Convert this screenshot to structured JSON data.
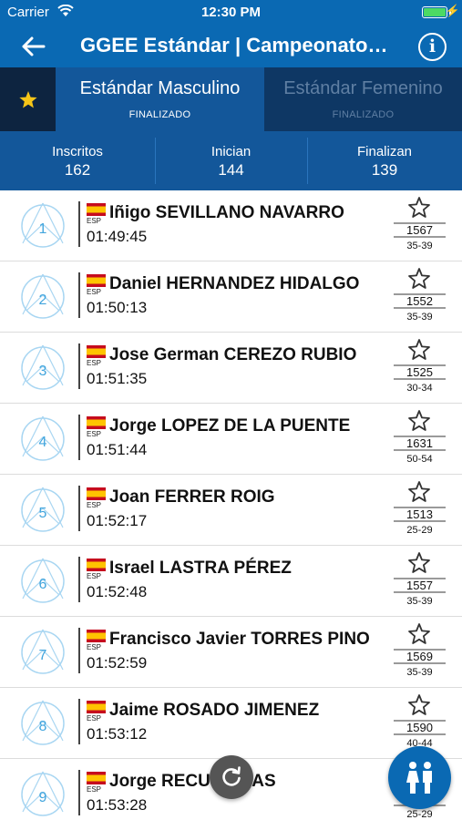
{
  "status_bar": {
    "carrier": "Carrier",
    "time": "12:30 PM"
  },
  "navbar": {
    "title": "GGEE Estándar | Campeonato…",
    "back_icon": "back-arrow-icon",
    "info_icon": "info-icon",
    "info_glyph": "i"
  },
  "tabs": [
    {
      "label": "Estándar Masculino",
      "status": "FINALIZADO",
      "active": true
    },
    {
      "label": "Estándar Femenino",
      "status": "FINALIZADO",
      "active": false
    }
  ],
  "stats": [
    {
      "label": "Inscritos",
      "value": "162"
    },
    {
      "label": "Inician",
      "value": "144"
    },
    {
      "label": "Finalizan",
      "value": "139"
    }
  ],
  "results": [
    {
      "position": "1",
      "country": "ESP",
      "name": "Iñigo SEVILLANO NAVARRO",
      "time": "01:49:45",
      "score": "1567",
      "category": "35-39"
    },
    {
      "position": "2",
      "country": "ESP",
      "name": "Daniel HERNANDEZ HIDALGO",
      "time": "01:50:13",
      "score": "1552",
      "category": "35-39"
    },
    {
      "position": "3",
      "country": "ESP",
      "name": "Jose German CEREZO RUBIO",
      "time": "01:51:35",
      "score": "1525",
      "category": "30-34"
    },
    {
      "position": "4",
      "country": "ESP",
      "name": "Jorge LOPEZ DE LA PUENTE",
      "time": "01:51:44",
      "score": "1631",
      "category": "50-54"
    },
    {
      "position": "5",
      "country": "ESP",
      "name": "Joan FERRER ROIG",
      "time": "01:52:17",
      "score": "1513",
      "category": "25-29"
    },
    {
      "position": "6",
      "country": "ESP",
      "name": "Israel LASTRA PÉREZ",
      "time": "01:52:48",
      "score": "1557",
      "category": "35-39"
    },
    {
      "position": "7",
      "country": "ESP",
      "name": "Francisco Javier TORRES PINO",
      "time": "01:52:59",
      "score": "1569",
      "category": "35-39"
    },
    {
      "position": "8",
      "country": "ESP",
      "name": "Jaime ROSADO JIMENEZ",
      "time": "01:53:12",
      "score": "1590",
      "category": "40-44"
    },
    {
      "position": "9",
      "country": "ESP",
      "name": "Jorge RECU   HERAS",
      "time": "01:53:28",
      "score": "",
      "category": "25-29"
    }
  ],
  "floating": {
    "refresh_icon": "refresh-icon",
    "gender_icon": "gender-filter-icon"
  },
  "colors": {
    "primary": "#0a69b3",
    "tab_dark": "#0e3764",
    "tab_active": "#13579a",
    "position_accent": "#42a5dd",
    "star": "#f5c518"
  }
}
